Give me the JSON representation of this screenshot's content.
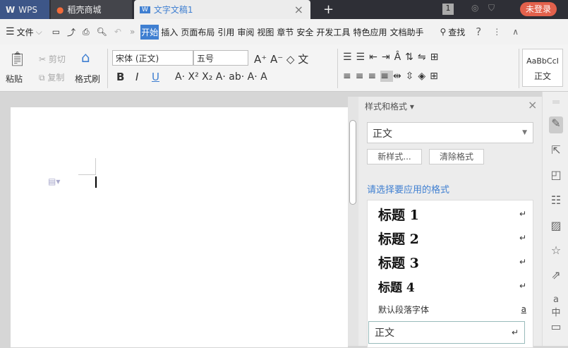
{
  "tabs": {
    "wps": "WPS",
    "store": "稻壳商城",
    "doc": "文字文稿1",
    "new": "+",
    "close": "×",
    "badge": "1",
    "login": "未登录"
  },
  "menu": {
    "file": "文件",
    "more": "»",
    "items": [
      "开始",
      "插入",
      "页面布局",
      "引用",
      "审阅",
      "视图",
      "章节",
      "安全",
      "开发工具",
      "特色应用",
      "文档助手"
    ],
    "find": "查找",
    "help": "?",
    "dots": "⋮",
    "collapse": "∧"
  },
  "ribbon": {
    "paste": "粘贴",
    "cut": "剪切",
    "copy": "复制",
    "format_painter": "格式刷",
    "font": "宋体 (正文)",
    "size": "五号",
    "bold": "B",
    "italic": "I",
    "underline": "U",
    "style_preview": "AaBbCcI",
    "style_name": "正文"
  },
  "panel": {
    "title": "样式和格式",
    "current_style": "正文",
    "new_style": "新样式...",
    "clear_format": "清除格式",
    "prompt": "请选择要应用的格式",
    "styles": [
      {
        "name": "标题 1",
        "mark": "↵"
      },
      {
        "name": "标题 2",
        "mark": "↵"
      },
      {
        "name": "标题 3",
        "mark": "↵"
      },
      {
        "name": "标题 4",
        "mark": "↵"
      },
      {
        "name": "默认段落字体",
        "mark": "a"
      },
      {
        "name": "正文",
        "mark": "↵"
      }
    ]
  },
  "colors": {
    "accent": "#3f7fd1",
    "login": "#e2614c"
  }
}
